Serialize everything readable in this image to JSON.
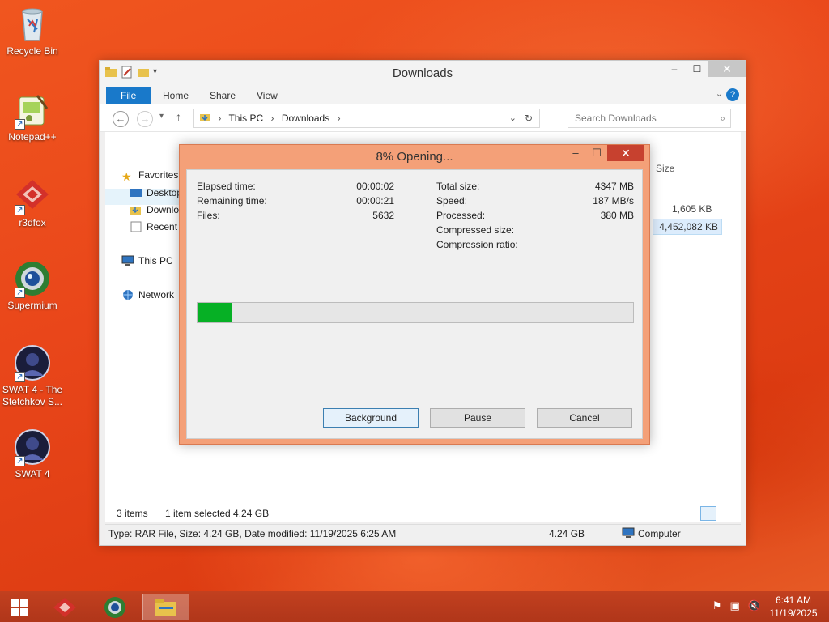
{
  "desktop": {
    "icons": [
      {
        "label": "Recycle Bin"
      },
      {
        "label": "Notepad++"
      },
      {
        "label": "r3dfox"
      },
      {
        "label": "Supermium"
      },
      {
        "label": "SWAT 4 - The Stetchkov S..."
      },
      {
        "label": "SWAT 4"
      }
    ]
  },
  "explorer": {
    "title": "Downloads",
    "tabs": {
      "file": "File",
      "home": "Home",
      "share": "Share",
      "view": "View"
    },
    "address": {
      "this_pc": "This PC",
      "downloads": "Downloads"
    },
    "search_placeholder": "Search Downloads",
    "nav": {
      "favorites": "Favorites",
      "desktop": "Desktop",
      "downloads": "Downloads",
      "recent": "Recent places",
      "this_pc": "This PC",
      "network": "Network"
    },
    "size_header": "Size",
    "sizes": [
      "1,605 KB",
      "4,452,082 KB"
    ],
    "status": {
      "items": "3 items",
      "selected": "1 item selected  4.24 GB"
    },
    "details": {
      "info": "Type: RAR File, Size: 4.24 GB, Date modified: 11/19/2025 6:25 AM",
      "size": "4.24 GB",
      "location": "Computer"
    }
  },
  "dialog": {
    "title": "8% Opening...",
    "progress_fraction": 0.08,
    "fields_left": [
      {
        "label": "Elapsed time:",
        "value": "00:00:02"
      },
      {
        "label": "Remaining time:",
        "value": "00:00:21"
      },
      {
        "label": "Files:",
        "value": "5632"
      }
    ],
    "fields_right": [
      {
        "label": "Total size:",
        "value": "4347 MB"
      },
      {
        "label": "Speed:",
        "value": "187 MB/s"
      },
      {
        "label": "Processed:",
        "value": "380 MB"
      },
      {
        "label": "Compressed size:",
        "value": ""
      },
      {
        "label": "Compression ratio:",
        "value": ""
      }
    ],
    "buttons": {
      "background": "Background",
      "pause": "Pause",
      "cancel": "Cancel"
    }
  },
  "taskbar": {
    "clock_time": "6:41 AM",
    "clock_date": "11/19/2025"
  },
  "colors": {
    "accent": "#1979ca",
    "progress": "#06b025",
    "dialog_frame": "#f4a078",
    "taskbar": "#b83a1a"
  }
}
